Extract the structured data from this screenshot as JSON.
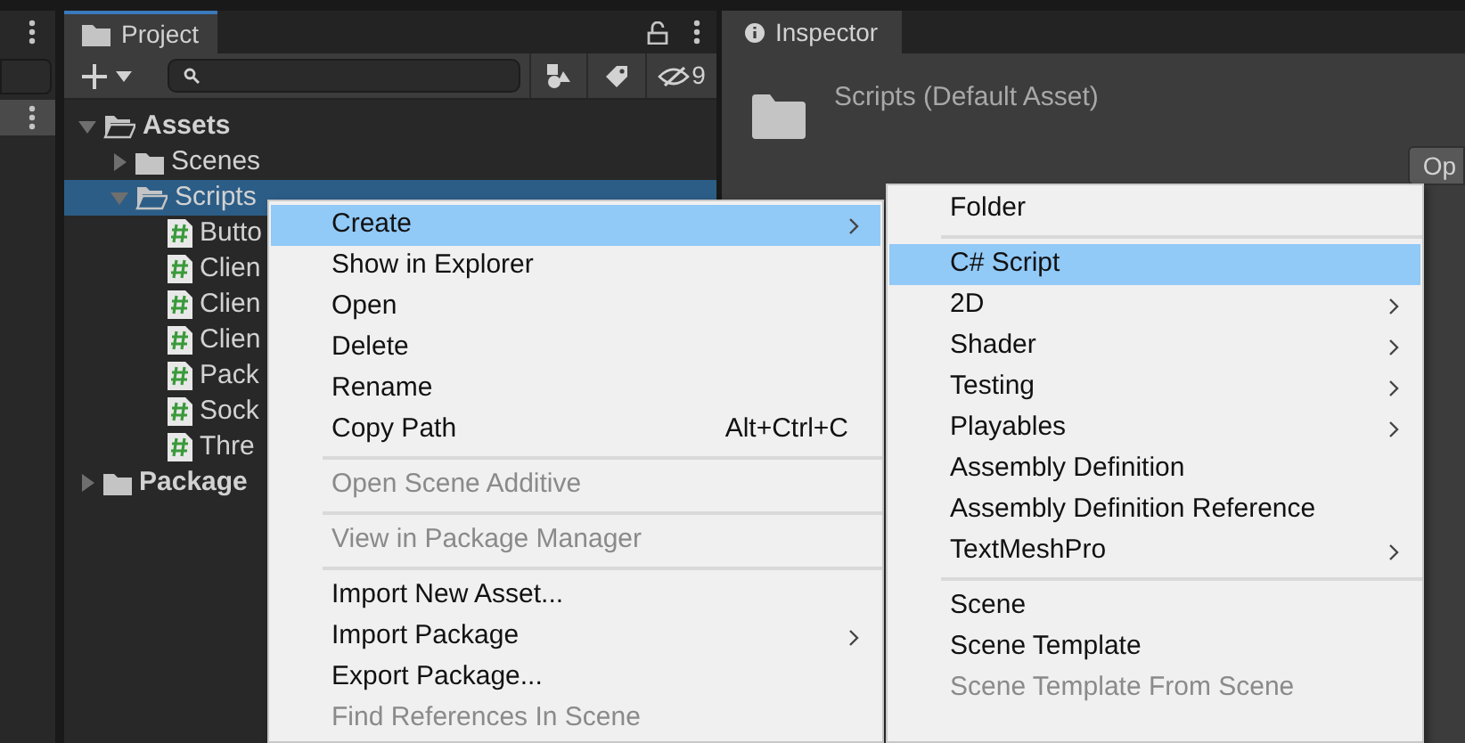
{
  "project": {
    "title": "Project",
    "hidden_count": "9",
    "tree": [
      {
        "label": "Assets",
        "kind": "folder",
        "expanded": true,
        "selected": false,
        "children": [
          {
            "label": "Scenes",
            "kind": "folder",
            "expanded": false,
            "selected": false
          },
          {
            "label": "Scripts",
            "kind": "folder",
            "expanded": true,
            "selected": true,
            "children": [
              {
                "label": "Butto",
                "kind": "script",
                "selected": false
              },
              {
                "label": "Clien",
                "kind": "script",
                "selected": false
              },
              {
                "label": "Clien",
                "kind": "script",
                "selected": false
              },
              {
                "label": "Clien",
                "kind": "script",
                "selected": false
              },
              {
                "label": "Pack",
                "kind": "script",
                "selected": false
              },
              {
                "label": "Sock",
                "kind": "script",
                "selected": false
              },
              {
                "label": "Thre",
                "kind": "script",
                "selected": false
              }
            ]
          }
        ]
      },
      {
        "label": "Package",
        "kind": "folder",
        "expanded": false,
        "selected": false
      }
    ]
  },
  "inspector": {
    "title": "Inspector",
    "asset_title": "Scripts (Default Asset)",
    "button": "Op"
  },
  "context_menu": {
    "items": [
      {
        "kind": "item",
        "label": "Create",
        "selected": true,
        "disabled": false,
        "submenu": true
      },
      {
        "kind": "item",
        "label": "Show in Explorer",
        "selected": false,
        "disabled": false,
        "submenu": false
      },
      {
        "kind": "item",
        "label": "Open",
        "selected": false,
        "disabled": false,
        "submenu": false
      },
      {
        "kind": "item",
        "label": "Delete",
        "selected": false,
        "disabled": false,
        "submenu": false
      },
      {
        "kind": "item",
        "label": "Rename",
        "selected": false,
        "disabled": false,
        "submenu": false
      },
      {
        "kind": "item",
        "label": "Copy Path",
        "shortcut": "Alt+Ctrl+C",
        "selected": false,
        "disabled": false,
        "submenu": false
      },
      {
        "kind": "separator"
      },
      {
        "kind": "item",
        "label": "Open Scene Additive",
        "selected": false,
        "disabled": true,
        "submenu": false
      },
      {
        "kind": "separator"
      },
      {
        "kind": "item",
        "label": "View in Package Manager",
        "selected": false,
        "disabled": true,
        "submenu": false
      },
      {
        "kind": "separator"
      },
      {
        "kind": "item",
        "label": "Import New Asset...",
        "selected": false,
        "disabled": false,
        "submenu": false
      },
      {
        "kind": "item",
        "label": "Import Package",
        "selected": false,
        "disabled": false,
        "submenu": true
      },
      {
        "kind": "item",
        "label": "Export Package...",
        "selected": false,
        "disabled": false,
        "submenu": false
      },
      {
        "kind": "item",
        "label": "Find References In Scene",
        "selected": false,
        "disabled": true,
        "submenu": false
      }
    ]
  },
  "create_submenu": {
    "items": [
      {
        "kind": "item",
        "label": "Folder",
        "selected": false,
        "disabled": false,
        "submenu": false
      },
      {
        "kind": "separator"
      },
      {
        "kind": "item",
        "label": "C# Script",
        "selected": true,
        "disabled": false,
        "submenu": false
      },
      {
        "kind": "item",
        "label": "2D",
        "selected": false,
        "disabled": false,
        "submenu": true
      },
      {
        "kind": "item",
        "label": "Shader",
        "selected": false,
        "disabled": false,
        "submenu": true
      },
      {
        "kind": "item",
        "label": "Testing",
        "selected": false,
        "disabled": false,
        "submenu": true
      },
      {
        "kind": "item",
        "label": "Playables",
        "selected": false,
        "disabled": false,
        "submenu": true
      },
      {
        "kind": "item",
        "label": "Assembly Definition",
        "selected": false,
        "disabled": false,
        "submenu": false
      },
      {
        "kind": "item",
        "label": "Assembly Definition Reference",
        "selected": false,
        "disabled": false,
        "submenu": false
      },
      {
        "kind": "item",
        "label": "TextMeshPro",
        "selected": false,
        "disabled": false,
        "submenu": true
      },
      {
        "kind": "separator"
      },
      {
        "kind": "item",
        "label": "Scene",
        "selected": false,
        "disabled": false,
        "submenu": false
      },
      {
        "kind": "item",
        "label": "Scene Template",
        "selected": false,
        "disabled": false,
        "submenu": false
      },
      {
        "kind": "item",
        "label": "Scene Template From Scene",
        "selected": false,
        "disabled": true,
        "submenu": false
      }
    ]
  }
}
